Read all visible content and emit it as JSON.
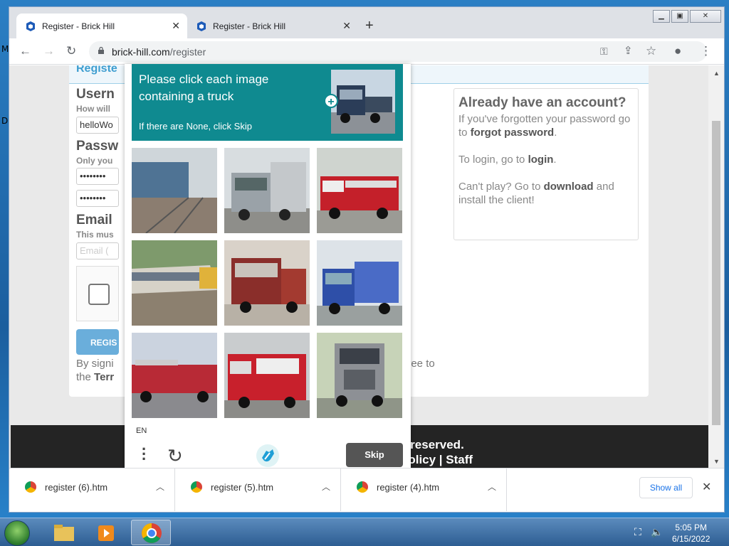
{
  "desktop": {
    "side_letters": [
      "M",
      "D"
    ]
  },
  "browser": {
    "tabs": [
      {
        "title": "Register - Brick Hill",
        "active": true
      },
      {
        "title": "Register - Brick Hill",
        "active": false
      }
    ],
    "url_host": "brick-hill.com",
    "url_path": "/register"
  },
  "page": {
    "header": "Registe",
    "username_label": "Usern",
    "username_hint": "How will",
    "username_value": "helloWo",
    "password_label": "Passw",
    "password_hint": "Only you",
    "password_value": "••••••••",
    "confirm_value": "••••••••",
    "email_label": "Email",
    "email_hint": "This mus",
    "email_placeholder": "Email (",
    "register_button": "REGIS",
    "legal_line1": "By signi",
    "legal_agree": "gree to",
    "legal_line2_prefix": "the",
    "legal_terms": "Terr",
    "side": {
      "heading": "Already have an account?",
      "p1_prefix": "If you've forgotten your password go to",
      "p1_link": "forgot password",
      "p1_suffix": ".",
      "p2_prefix": "To login, go to",
      "p2_link": "login",
      "p2_suffix": ".",
      "p3_prefix": "Can't play? Go to",
      "p3_link": "download",
      "p3_suffix": "and install the client!"
    },
    "footer_rights": "s reserved.",
    "footer_links": "Policy | Staff"
  },
  "captcha": {
    "prompt": "Please click each image containing a truck",
    "subtext": "If there are None, click Skip",
    "language": "EN",
    "skip_label": "Skip",
    "images": [
      {
        "subject": "train-on-tracks"
      },
      {
        "subject": "silver-truck"
      },
      {
        "subject": "fire-truck"
      },
      {
        "subject": "passenger-train"
      },
      {
        "subject": "red-truck"
      },
      {
        "subject": "blue-truck"
      },
      {
        "subject": "fire-truck"
      },
      {
        "subject": "fire-truck"
      },
      {
        "subject": "silver-truck"
      }
    ]
  },
  "downloads": [
    {
      "name": "register (6).htm"
    },
    {
      "name": "register (5).htm"
    },
    {
      "name": "register (4).htm"
    }
  ],
  "shelf": {
    "show_all": "Show all"
  },
  "taskbar": {
    "time": "5:05 PM",
    "date": "6/15/2022"
  }
}
